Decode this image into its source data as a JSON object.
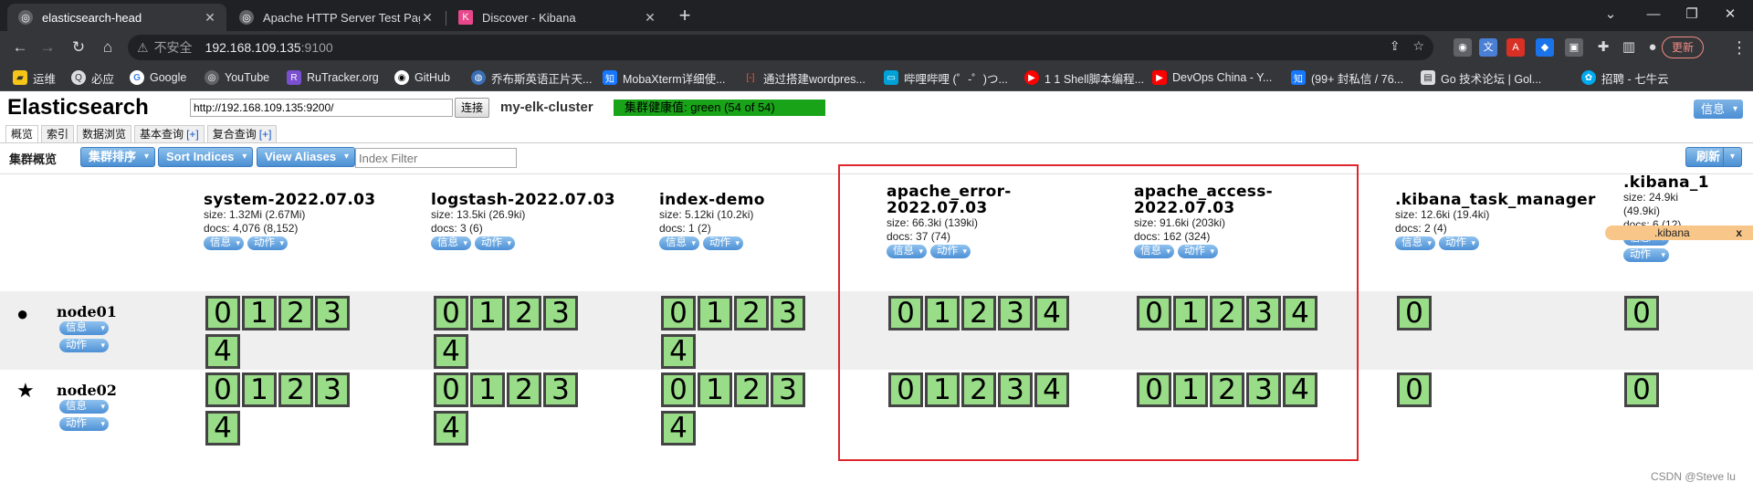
{
  "browser": {
    "tabs": [
      {
        "title": "elasticsearch-head",
        "active": true
      },
      {
        "title": "Apache HTTP Server Test Page",
        "active": false
      },
      {
        "title": "Discover - Kibana",
        "active": false
      }
    ],
    "url_insecure_label": "不安全",
    "url_host": "192.168.109.135",
    "url_port": ":9100",
    "update_label": "更新",
    "bookmarks": [
      "运维",
      "必应",
      "Google",
      "YouTube",
      "RuTracker.org",
      "GitHub",
      "乔布斯英语正片天...",
      "MobaXterm详细使...",
      "通过搭建wordpres...",
      "哔哩哔哩 (゜-゜)つ...",
      "1 1 Shell脚本编程...",
      "DevOps China - Y...",
      "(99+ 封私信 / 76...",
      "Go 技术论坛 | Gol...",
      "招聘 - 七牛云"
    ]
  },
  "head": {
    "logo": "Elasticsearch",
    "connect_url": "http://192.168.109.135:9200/",
    "connect_label": "连接",
    "cluster_name": "my-elk-cluster",
    "health": "集群健康值: green (54 of 54)",
    "info_label": "信息",
    "tabs": [
      {
        "label": "概览",
        "plus": ""
      },
      {
        "label": "索引",
        "plus": ""
      },
      {
        "label": "数据浏览",
        "plus": ""
      },
      {
        "label": "基本查询",
        "plus": "[+]"
      },
      {
        "label": "复合查询",
        "plus": "[+]"
      }
    ],
    "page_title": "集群概览",
    "sort_cluster": "集群排序",
    "sort_indices": "Sort Indices",
    "view_aliases": "View Aliases",
    "index_filter_placeholder": "Index Filter",
    "refresh_label": "刷新",
    "pill_info": "信息",
    "pill_action": "动作"
  },
  "indices": [
    {
      "name": "system-2022.07.03",
      "size": "size: 1.32Mi (2.67Mi)",
      "docs": "docs: 4,076 (8,152)",
      "shards": [
        "0",
        "1",
        "2",
        "3",
        "4"
      ]
    },
    {
      "name": "logstash-2022.07.03",
      "size": "size: 13.5ki (26.9ki)",
      "docs": "docs: 3 (6)",
      "shards": [
        "0",
        "1",
        "2",
        "3",
        "4"
      ]
    },
    {
      "name": "index-demo",
      "size": "size: 5.12ki (10.2ki)",
      "docs": "docs: 1 (2)",
      "shards": [
        "0",
        "1",
        "2",
        "3",
        "4"
      ]
    },
    {
      "name_line1": "apache_error-",
      "name_line2": "2022.07.03",
      "size": "size: 66.3ki (139ki)",
      "docs": "docs: 37 (74)",
      "shards": [
        "0",
        "1",
        "2",
        "3",
        "4"
      ]
    },
    {
      "name_line1": "apache_access-",
      "name_line2": "2022.07.03",
      "size": "size: 91.6ki (203ki)",
      "docs": "docs: 162 (324)",
      "shards": [
        "0",
        "1",
        "2",
        "3",
        "4"
      ]
    },
    {
      "name": ".kibana_task_manager",
      "size": "size: 12.6ki (19.4ki)",
      "docs": "docs: 2 (4)",
      "shards": [
        "0"
      ]
    },
    {
      "name": ".kibana_1",
      "size": "size: 24.9ki",
      "size2": "(49.9ki)",
      "docs": "docs: 6 (12)",
      "shards": [
        "0"
      ],
      "alias": ".kibana",
      "alias_close": "x"
    }
  ],
  "nodes": [
    {
      "name": "node01",
      "symbol": "●",
      "symbol_name": "master-dot-icon"
    },
    {
      "name": "node02",
      "symbol": "★",
      "symbol_name": "star-icon"
    }
  ],
  "watermark": "CSDN @Steve lu"
}
